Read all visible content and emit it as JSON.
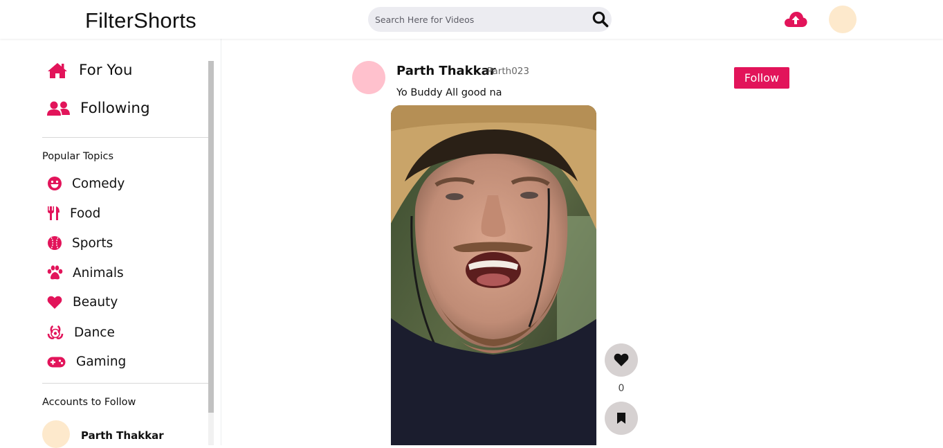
{
  "app": {
    "logo": "FilterShorts"
  },
  "search": {
    "placeholder": "Search Here for Videos"
  },
  "colors": {
    "accent": "#e2145a",
    "header_avatar": "#fde9cc",
    "post_avatar": "#ffc1cd",
    "action_button": "#d6d1d1"
  },
  "sidebar": {
    "main_nav": [
      {
        "label": "For You",
        "icon": "home-icon"
      },
      {
        "label": "Following",
        "icon": "users-icon"
      }
    ],
    "popular_topics_title": "Popular Topics",
    "topics": [
      {
        "label": "Comedy",
        "icon": "smile-icon"
      },
      {
        "label": "Food",
        "icon": "utensils-icon"
      },
      {
        "label": "Sports",
        "icon": "baseball-icon"
      },
      {
        "label": "Animals",
        "icon": "paw-icon"
      },
      {
        "label": "Beauty",
        "icon": "heart-icon"
      },
      {
        "label": "Dance",
        "icon": "biohazard-icon"
      },
      {
        "label": "Gaming",
        "icon": "gamepad-icon"
      }
    ],
    "accounts_title": "Accounts to Follow",
    "accounts": [
      {
        "name": "Parth Thakkar"
      }
    ]
  },
  "post": {
    "author_name": "Parth Thakkar",
    "author_handle": "Parth023",
    "caption": "Yo Buddy All good na",
    "follow_label": "Follow",
    "likes": "0"
  }
}
